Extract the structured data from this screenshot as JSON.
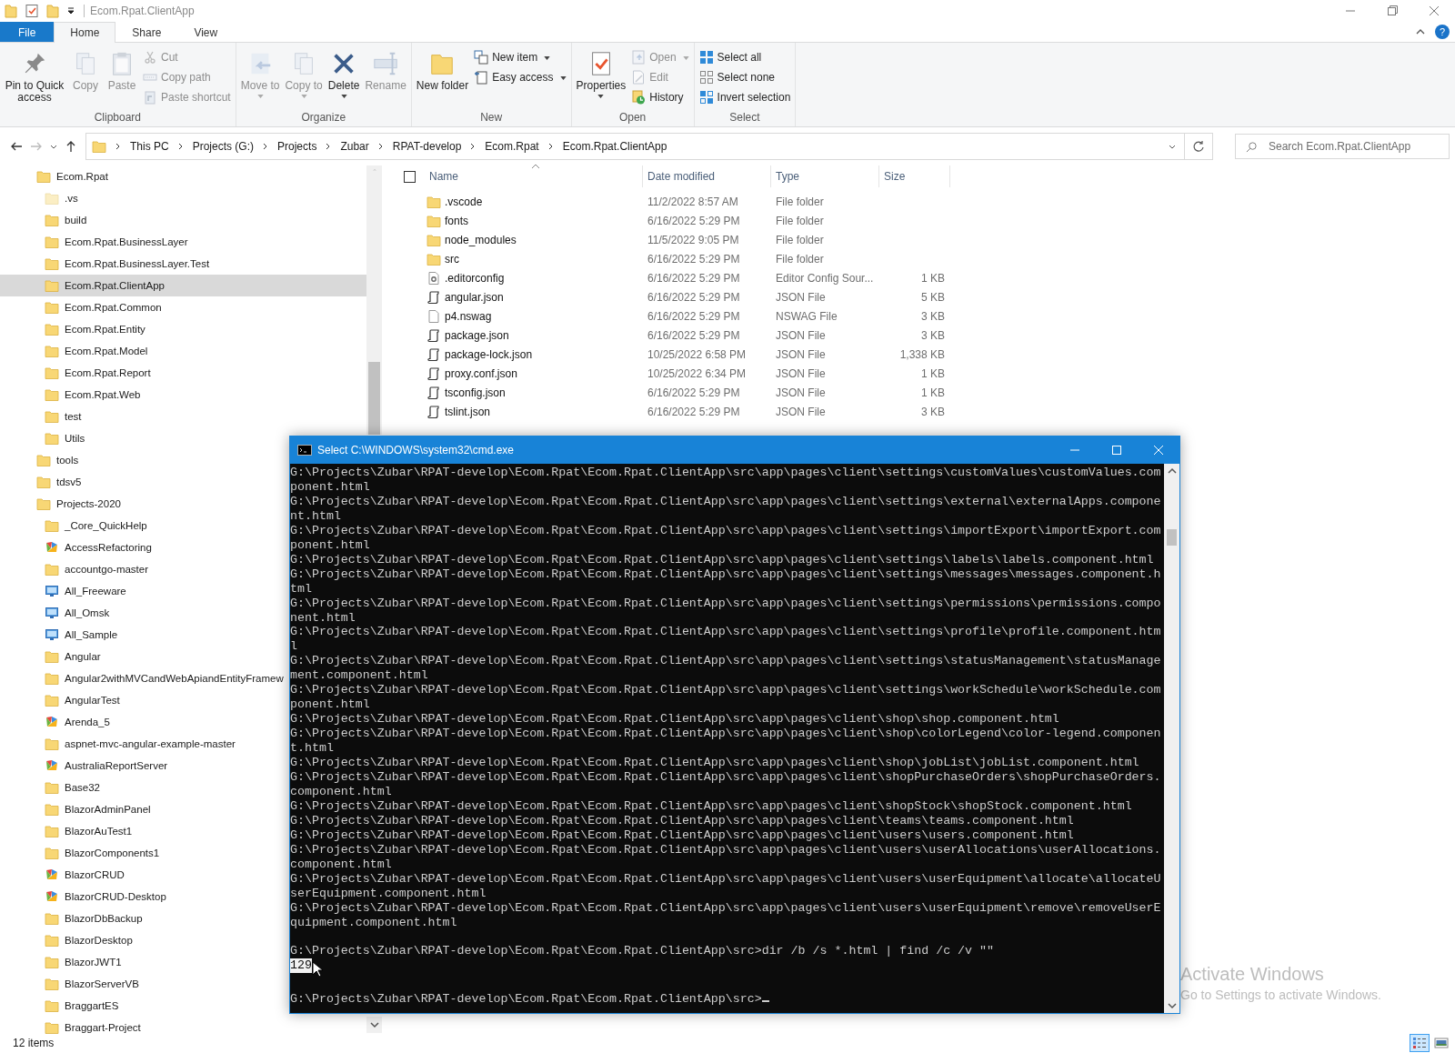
{
  "window": {
    "title": "Ecom.Rpat.ClientApp"
  },
  "help_button": "?",
  "ribbon_tabs": [
    {
      "label": "File",
      "kind": "file",
      "selected": false
    },
    {
      "label": "Home",
      "kind": "tab",
      "selected": true
    },
    {
      "label": "Share",
      "kind": "tab",
      "selected": false
    },
    {
      "label": "View",
      "kind": "tab",
      "selected": false
    }
  ],
  "ribbon_groups": [
    {
      "label": "Clipboard",
      "buttons": [
        {
          "label": "Pin to Quick access",
          "kind": "pin",
          "disabled": false,
          "dropdown": false
        },
        {
          "label": "Copy",
          "kind": "copy",
          "disabled": true,
          "dropdown": false
        },
        {
          "label": "Paste",
          "kind": "paste",
          "disabled": true,
          "dropdown": false
        },
        {
          "label": "Cut",
          "kind": "cut",
          "disabled": true,
          "dropdown": false
        },
        {
          "label": "Copy path",
          "kind": "copy-path",
          "disabled": true,
          "dropdown": false
        },
        {
          "label": "Paste shortcut",
          "kind": "paste-shortcut",
          "disabled": true,
          "dropdown": false
        }
      ]
    },
    {
      "label": "Organize",
      "buttons": [
        {
          "label": "Move to",
          "kind": "move",
          "disabled": true,
          "dropdown": true
        },
        {
          "label": "Copy to",
          "kind": "copy-to",
          "disabled": true,
          "dropdown": true
        },
        {
          "label": "Delete",
          "kind": "delete",
          "disabled": false,
          "dropdown": true
        },
        {
          "label": "Rename",
          "kind": "rename",
          "disabled": true,
          "dropdown": false
        }
      ]
    },
    {
      "label": "New",
      "buttons": [
        {
          "label": "New folder",
          "kind": "new-folder",
          "disabled": false,
          "dropdown": false
        },
        {
          "label": "New item",
          "kind": "new-item",
          "disabled": false,
          "dropdown": true
        },
        {
          "label": "Easy access",
          "kind": "easy-access",
          "disabled": false,
          "dropdown": true
        }
      ]
    },
    {
      "label": "Open",
      "buttons": [
        {
          "label": "Properties",
          "kind": "properties",
          "disabled": false,
          "dropdown": true
        },
        {
          "label": "Open",
          "kind": "open",
          "disabled": true,
          "dropdown": true
        },
        {
          "label": "Edit",
          "kind": "edit",
          "disabled": true,
          "dropdown": false
        },
        {
          "label": "History",
          "kind": "history",
          "disabled": false,
          "dropdown": false
        }
      ]
    },
    {
      "label": "Select",
      "buttons": [
        {
          "label": "Select all",
          "kind": "select-all",
          "disabled": false,
          "dropdown": false
        },
        {
          "label": "Select none",
          "kind": "select-none",
          "disabled": false,
          "dropdown": false
        },
        {
          "label": "Invert selection",
          "kind": "invert",
          "disabled": false,
          "dropdown": false
        }
      ]
    }
  ],
  "address_bar": {
    "crumbs": [
      "This PC",
      "Projects (G:)",
      "Projects",
      "Zubar",
      "RPAT-develop",
      "Ecom.Rpat",
      "Ecom.Rpat.ClientApp"
    ]
  },
  "search": {
    "placeholder": "Search Ecom.Rpat.ClientApp"
  },
  "sidebar": {
    "tree": [
      {
        "label": "Ecom.Rpat",
        "kind": "folder",
        "selected": false,
        "children": [
          {
            "label": ".vs",
            "kind": "hidden-folder",
            "selected": false
          },
          {
            "label": "build",
            "kind": "folder",
            "selected": false
          },
          {
            "label": "Ecom.Rpat.BusinessLayer",
            "kind": "folder",
            "selected": false
          },
          {
            "label": "Ecom.Rpat.BusinessLayer.Test",
            "kind": "folder",
            "selected": false
          },
          {
            "label": "Ecom.Rpat.ClientApp",
            "kind": "folder",
            "selected": true
          },
          {
            "label": "Ecom.Rpat.Common",
            "kind": "folder",
            "selected": false
          },
          {
            "label": "Ecom.Rpat.Entity",
            "kind": "folder",
            "selected": false
          },
          {
            "label": "Ecom.Rpat.Model",
            "kind": "folder",
            "selected": false
          },
          {
            "label": "Ecom.Rpat.Report",
            "kind": "folder",
            "selected": false
          },
          {
            "label": "Ecom.Rpat.Web",
            "kind": "folder",
            "selected": false
          },
          {
            "label": "test",
            "kind": "folder",
            "selected": false
          },
          {
            "label": "Utils",
            "kind": "folder",
            "selected": false
          }
        ]
      },
      {
        "label": "tools",
        "kind": "folder",
        "selected": false
      },
      {
        "label": "tdsv5",
        "kind": "folder",
        "selected": false
      },
      {
        "label": "Projects-2020",
        "kind": "folder",
        "selected": false,
        "children": [
          {
            "label": "_Core_QuickHelp",
            "kind": "folder",
            "selected": false
          },
          {
            "label": "AccessRefactoring",
            "kind": "project",
            "selected": false
          },
          {
            "label": "accountgo-master",
            "kind": "folder",
            "selected": false
          },
          {
            "label": "All_Freeware",
            "kind": "drive",
            "selected": false
          },
          {
            "label": "All_Omsk",
            "kind": "drive",
            "selected": false
          },
          {
            "label": "All_Sample",
            "kind": "drive",
            "selected": false
          },
          {
            "label": "Angular",
            "kind": "folder",
            "selected": false
          },
          {
            "label": "Angular2withMVCandWebApiandEntityFramew",
            "kind": "folder",
            "selected": false
          },
          {
            "label": "AngularTest",
            "kind": "folder",
            "selected": false
          },
          {
            "label": "Arenda_5",
            "kind": "project",
            "selected": false
          },
          {
            "label": "aspnet-mvc-angular-example-master",
            "kind": "folder",
            "selected": false
          },
          {
            "label": "AustraliaReportServer",
            "kind": "project",
            "selected": false
          },
          {
            "label": "Base32",
            "kind": "folder",
            "selected": false
          },
          {
            "label": "BlazorAdminPanel",
            "kind": "folder",
            "selected": false
          },
          {
            "label": "BlazorAuTest1",
            "kind": "folder",
            "selected": false
          },
          {
            "label": "BlazorComponents1",
            "kind": "folder",
            "selected": false
          },
          {
            "label": "BlazorCRUD",
            "kind": "project",
            "selected": false
          },
          {
            "label": "BlazorCRUD-Desktop",
            "kind": "project",
            "selected": false
          },
          {
            "label": "BlazorDbBackup",
            "kind": "folder",
            "selected": false
          },
          {
            "label": "BlazorDesktop",
            "kind": "folder",
            "selected": false
          },
          {
            "label": "BlazorJWT1",
            "kind": "folder",
            "selected": false
          },
          {
            "label": "BlazorServerVB",
            "kind": "folder",
            "selected": false
          },
          {
            "label": "BraggartES",
            "kind": "folder",
            "selected": false
          },
          {
            "label": "Braggart-Project",
            "kind": "folder",
            "selected": false
          }
        ]
      }
    ]
  },
  "file_list": {
    "select_all_checked": false,
    "columns": [
      "Name",
      "Date modified",
      "Type",
      "Size"
    ],
    "rows": [
      {
        "name": ".vscode",
        "date": "11/2/2022 8:57 AM",
        "type": "File folder",
        "kind": "folder"
      },
      {
        "name": "fonts",
        "date": "6/16/2022 5:29 PM",
        "type": "File folder",
        "kind": "folder"
      },
      {
        "name": "node_modules",
        "date": "11/5/2022 9:05 PM",
        "type": "File folder",
        "kind": "folder"
      },
      {
        "name": "src",
        "date": "6/16/2022 5:29 PM",
        "type": "File folder",
        "kind": "folder"
      },
      {
        "name": ".editorconfig",
        "date": "6/16/2022 5:29 PM",
        "type": "Editor Config Sour...",
        "size": "1 KB",
        "kind": "config"
      },
      {
        "name": "angular.json",
        "date": "6/16/2022 5:29 PM",
        "type": "JSON File",
        "size": "5 KB",
        "kind": "json"
      },
      {
        "name": "p4.nswag",
        "date": "6/16/2022 5:29 PM",
        "type": "NSWAG File",
        "size": "3 KB",
        "kind": "file"
      },
      {
        "name": "package.json",
        "date": "6/16/2022 5:29 PM",
        "type": "JSON File",
        "size": "3 KB",
        "kind": "json"
      },
      {
        "name": "package-lock.json",
        "date": "10/25/2022 6:58 PM",
        "type": "JSON File",
        "size": "1,338 KB",
        "kind": "json"
      },
      {
        "name": "proxy.conf.json",
        "date": "10/25/2022 6:34 PM",
        "type": "JSON File",
        "size": "1 KB",
        "kind": "json"
      },
      {
        "name": "tsconfig.json",
        "date": "6/16/2022 5:29 PM",
        "type": "JSON File",
        "size": "1 KB",
        "kind": "json"
      },
      {
        "name": "tslint.json",
        "date": "6/16/2022 5:29 PM",
        "type": "JSON File",
        "size": "3 KB",
        "kind": "json"
      }
    ]
  },
  "status_bar": {
    "item_count": "12 items",
    "views": [
      {
        "kind": "details",
        "selected": true
      },
      {
        "kind": "large-icons",
        "selected": false
      }
    ]
  },
  "console": {
    "title": "Select C:\\WINDOWS\\system32\\cmd.exe",
    "cursor": true,
    "lines": [
      {
        "kind": "text",
        "text": "G:\\Projects\\Zubar\\RPAT-develop\\Ecom.Rpat\\Ecom.Rpat.ClientApp\\src\\app\\pages\\client\\settings\\customValues\\customValues.component.html"
      },
      {
        "kind": "text",
        "text": "G:\\Projects\\Zubar\\RPAT-develop\\Ecom.Rpat\\Ecom.Rpat.ClientApp\\src\\app\\pages\\client\\settings\\external\\externalApps.component.html"
      },
      {
        "kind": "text",
        "text": "G:\\Projects\\Zubar\\RPAT-develop\\Ecom.Rpat\\Ecom.Rpat.ClientApp\\src\\app\\pages\\client\\settings\\importExport\\importExport.component.html"
      },
      {
        "kind": "text",
        "text": "G:\\Projects\\Zubar\\RPAT-develop\\Ecom.Rpat\\Ecom.Rpat.ClientApp\\src\\app\\pages\\client\\settings\\labels\\labels.component.html"
      },
      {
        "kind": "text",
        "text": "G:\\Projects\\Zubar\\RPAT-develop\\Ecom.Rpat\\Ecom.Rpat.ClientApp\\src\\app\\pages\\client\\settings\\messages\\messages.component.html"
      },
      {
        "kind": "text",
        "text": "G:\\Projects\\Zubar\\RPAT-develop\\Ecom.Rpat\\Ecom.Rpat.ClientApp\\src\\app\\pages\\client\\settings\\permissions\\permissions.component.html"
      },
      {
        "kind": "text",
        "text": "G:\\Projects\\Zubar\\RPAT-develop\\Ecom.Rpat\\Ecom.Rpat.ClientApp\\src\\app\\pages\\client\\settings\\profile\\profile.component.html"
      },
      {
        "kind": "text",
        "text": "G:\\Projects\\Zubar\\RPAT-develop\\Ecom.Rpat\\Ecom.Rpat.ClientApp\\src\\app\\pages\\client\\settings\\statusManagement\\statusManagement.component.html"
      },
      {
        "kind": "text",
        "text": "G:\\Projects\\Zubar\\RPAT-develop\\Ecom.Rpat\\Ecom.Rpat.ClientApp\\src\\app\\pages\\client\\settings\\workSchedule\\workSchedule.component.html"
      },
      {
        "kind": "text",
        "text": "G:\\Projects\\Zubar\\RPAT-develop\\Ecom.Rpat\\Ecom.Rpat.ClientApp\\src\\app\\pages\\client\\shop\\shop.component.html"
      },
      {
        "kind": "text",
        "text": "G:\\Projects\\Zubar\\RPAT-develop\\Ecom.Rpat\\Ecom.Rpat.ClientApp\\src\\app\\pages\\client\\shop\\colorLegend\\color-legend.component.html"
      },
      {
        "kind": "text",
        "text": "G:\\Projects\\Zubar\\RPAT-develop\\Ecom.Rpat\\Ecom.Rpat.ClientApp\\src\\app\\pages\\client\\shop\\jobList\\jobList.component.html"
      },
      {
        "kind": "text",
        "text": "G:\\Projects\\Zubar\\RPAT-develop\\Ecom.Rpat\\Ecom.Rpat.ClientApp\\src\\app\\pages\\client\\shopPurchaseOrders\\shopPurchaseOrders.component.html"
      },
      {
        "kind": "text",
        "text": "G:\\Projects\\Zubar\\RPAT-develop\\Ecom.Rpat\\Ecom.Rpat.ClientApp\\src\\app\\pages\\client\\shopStock\\shopStock.component.html"
      },
      {
        "kind": "text",
        "text": "G:\\Projects\\Zubar\\RPAT-develop\\Ecom.Rpat\\Ecom.Rpat.ClientApp\\src\\app\\pages\\client\\teams\\teams.component.html"
      },
      {
        "kind": "text",
        "text": "G:\\Projects\\Zubar\\RPAT-develop\\Ecom.Rpat\\Ecom.Rpat.ClientApp\\src\\app\\pages\\client\\users\\users.component.html"
      },
      {
        "kind": "text",
        "text": "G:\\Projects\\Zubar\\RPAT-develop\\Ecom.Rpat\\Ecom.Rpat.ClientApp\\src\\app\\pages\\client\\users\\userAllocations\\userAllocations.component.html"
      },
      {
        "kind": "text",
        "text": "G:\\Projects\\Zubar\\RPAT-develop\\Ecom.Rpat\\Ecom.Rpat.ClientApp\\src\\app\\pages\\client\\users\\userEquipment\\allocate\\allocateUserEquipment.component.html"
      },
      {
        "kind": "text",
        "text": "G:\\Projects\\Zubar\\RPAT-develop\\Ecom.Rpat\\Ecom.Rpat.ClientApp\\src\\app\\pages\\client\\users\\userEquipment\\remove\\removeUserEquipment.component.html"
      },
      {
        "kind": "blank"
      },
      {
        "kind": "text",
        "text": "G:\\Projects\\Zubar\\RPAT-develop\\Ecom.Rpat\\Ecom.Rpat.ClientApp\\src>dir /b /s *.html | find /c /v \"\""
      },
      {
        "kind": "selection",
        "text": "129"
      },
      {
        "kind": "blank"
      },
      {
        "kind": "text",
        "text": "G:\\Projects\\Zubar\\RPAT-develop\\Ecom.Rpat\\Ecom.Rpat.ClientApp\\src>"
      }
    ]
  },
  "activation_notice": {
    "title": "Activate Windows",
    "subtitle": "Go to Settings to activate Windows."
  }
}
